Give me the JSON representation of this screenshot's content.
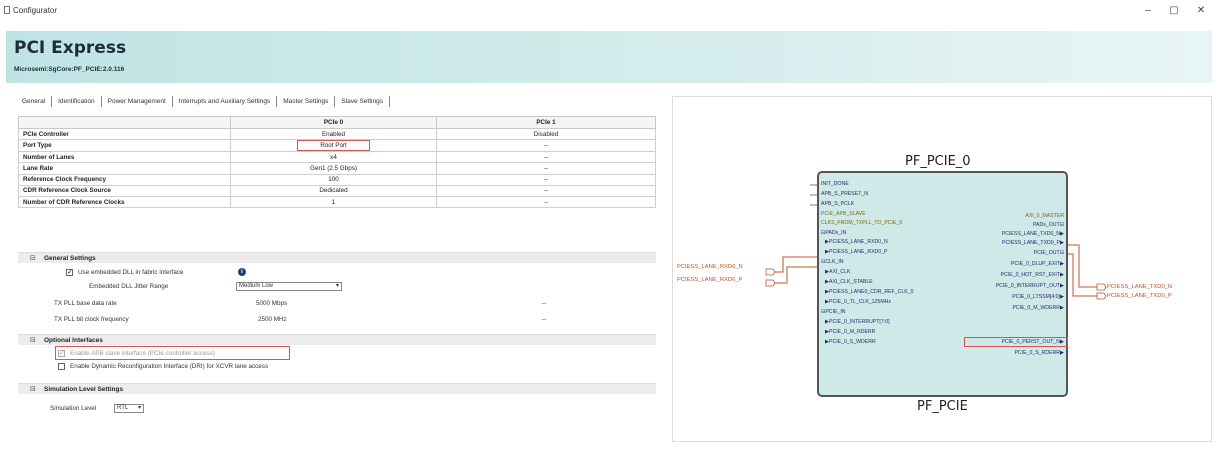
{
  "window": {
    "title": "Configurator",
    "minimize": "–",
    "maximize": "▢",
    "close": "✕"
  },
  "header": {
    "title": "PCI Express",
    "vlnv": "Microsemi:SgCore:PF_PCIE:2.0.116"
  },
  "tabs": [
    {
      "label": "General"
    },
    {
      "label": "Identification"
    },
    {
      "label": "Power Management"
    },
    {
      "label": "Interrupts and Auxiliary Settings"
    },
    {
      "label": "Master Settings"
    },
    {
      "label": "Slave Settings"
    }
  ],
  "table": {
    "headers": [
      "",
      "PCIe 0",
      "PCIe 1"
    ],
    "rows": [
      {
        "label": "PCIe Controller",
        "pcie0": "Enabled",
        "pcie1": "Disabled"
      },
      {
        "label": "Port Type",
        "pcie0": "Root Port",
        "pcie1": "--"
      },
      {
        "label": "Number of Lanes",
        "pcie0": "x4",
        "pcie1": "--"
      },
      {
        "label": "Lane Rate",
        "pcie0": "Gen1 (2.5 Gbps)",
        "pcie1": "--"
      },
      {
        "label": "Reference Clock Frequency",
        "pcie0": "100",
        "pcie1": "--"
      },
      {
        "label": "CDR Reference Clock Source",
        "pcie0": "Dedicated",
        "pcie1": "--"
      },
      {
        "label": "Number of CDR Reference Clocks",
        "pcie0": "1",
        "pcie1": "--"
      }
    ]
  },
  "general_settings": {
    "title": "General Settings",
    "toggle": "⊟",
    "use_dll_label": "Use embedded DLL in fabric interface",
    "use_dll_checked": "✓",
    "jitter_label": "Embedded DLL Jitter Range",
    "jitter_value": "Medium Low",
    "tx_pll_rate_label": "TX PLL base data rate",
    "tx_pll_rate_value": "5000 Mbps",
    "tx_pll_rate_pcie1": "--",
    "tx_pll_clk_label": "TX PLL bit clock frequency",
    "tx_pll_clk_value": "2500 MHz",
    "tx_pll_clk_pcie1": "--"
  },
  "optional_interfaces": {
    "title": "Optional Interfaces",
    "toggle": "⊟",
    "apb_label": "Enable APB slave interface (PCIe controller access)",
    "apb_checked": "✓",
    "drp_label": "Enable Dynamic Reconfiguration Interface (DRI) for XCVR lane access"
  },
  "simulation": {
    "title": "Simulation Level Settings",
    "toggle": "⊟",
    "level_label": "Simulation Level",
    "level_value": "RTL"
  },
  "diagram": {
    "instance_name": "PF_PCIE_0",
    "component_name": "PF_PCIE",
    "left_pins": [
      "INIT_DONE",
      "APB_S_PRESET_N",
      "APB_S_PCLK",
      "PCIE_APB_SLAVE",
      "CLKS_FROM_TXPLL_TO_PCIE_0",
      "⊟PADs_IN",
      "▶PCIESS_LANE_RXD0_N",
      "▶PCIESS_LANE_RXD0_P",
      "⊟CLK_IN",
      "▶AXI_CLK",
      "▶AXI_CLK_STABLE",
      "▶PCIESS_LANE0_CDR_REF_CLK_0",
      "▶PCIE_0_TL_CLK_125MHz",
      "⊟PCIE_IN",
      "▶PCIE_0_INTERRUPT[7:0]",
      "▶PCIE_0_M_RDERR",
      "▶PCIE_0_S_WDERR"
    ],
    "right_pins": [
      "AXI_0_MASTER",
      "PADs_OUT⊟",
      "PCIESS_LANE_TXD0_N▶",
      "PCIESS_LANE_TXD0_P▶",
      "PCIE_OUT⊟",
      "PCIE_0_DLUP_EXIT▶",
      "PCIE_0_HOT_RST_EXIT▶",
      "PCIE_0_INTERRUPT_OUT▶",
      "PCIE_0_LTSSM[4:0]▶",
      "PCIE_0_M_WDERR▶",
      "PCIE_0_PERST_OUT_N▶",
      "PCIE_0_S_RDERR▶"
    ],
    "ext_in": [
      "PCIESS_LANE_RXD0_N",
      "PCIESS_LANE_RXD0_P"
    ],
    "ext_out": [
      "PCIESS_LANE_TXD0_N",
      "PCIESS_LANE_TXD0_P"
    ]
  },
  "colors": {
    "highlight": "#d9534f",
    "banner": "#bfe3e3",
    "block_fill": "#cfe9e9",
    "external_port": "#c0542a"
  }
}
